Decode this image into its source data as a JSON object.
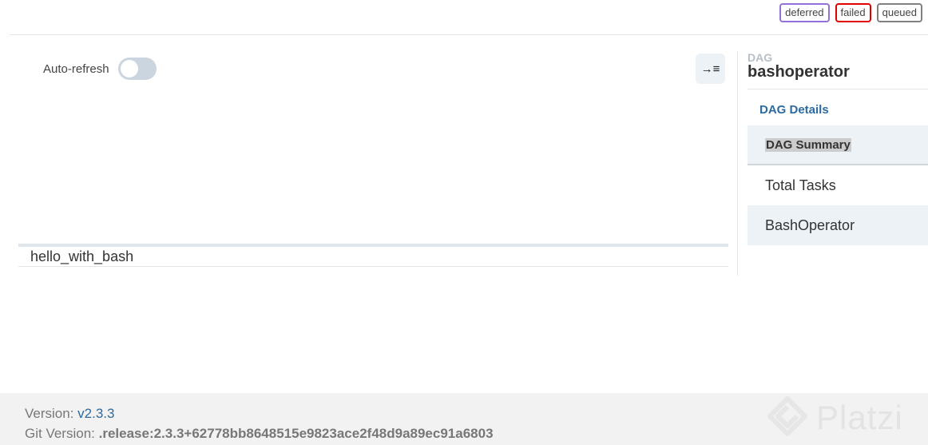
{
  "legend": [
    {
      "label": "deferred"
    },
    {
      "label": "failed"
    },
    {
      "label": "queued"
    }
  ],
  "toolbar": {
    "auto_refresh_label": "Auto-refresh",
    "auto_refresh_on": false,
    "collapse_icon": "→≡"
  },
  "grid": {
    "tasks": [
      {
        "name": "hello_with_bash"
      }
    ]
  },
  "details": {
    "caption": "DAG",
    "dag_id": "bashoperator",
    "tab": "DAG Details",
    "summary_header": "DAG Summary",
    "rows": [
      {
        "label": "Total Tasks"
      },
      {
        "label": "BashOperator"
      }
    ]
  },
  "footer": {
    "version_label": "Version:",
    "version_value": "v2.3.3",
    "git_label": "Git Version:",
    "git_value": ".release:2.3.3+62778bb8648515e9823ace2f48d9a89ec91a6803",
    "watermark": "Platzi"
  },
  "colors": {
    "deferred": "#9370db",
    "failed": "#e00000",
    "queued": "#808080",
    "link": "#2c6aa0"
  }
}
